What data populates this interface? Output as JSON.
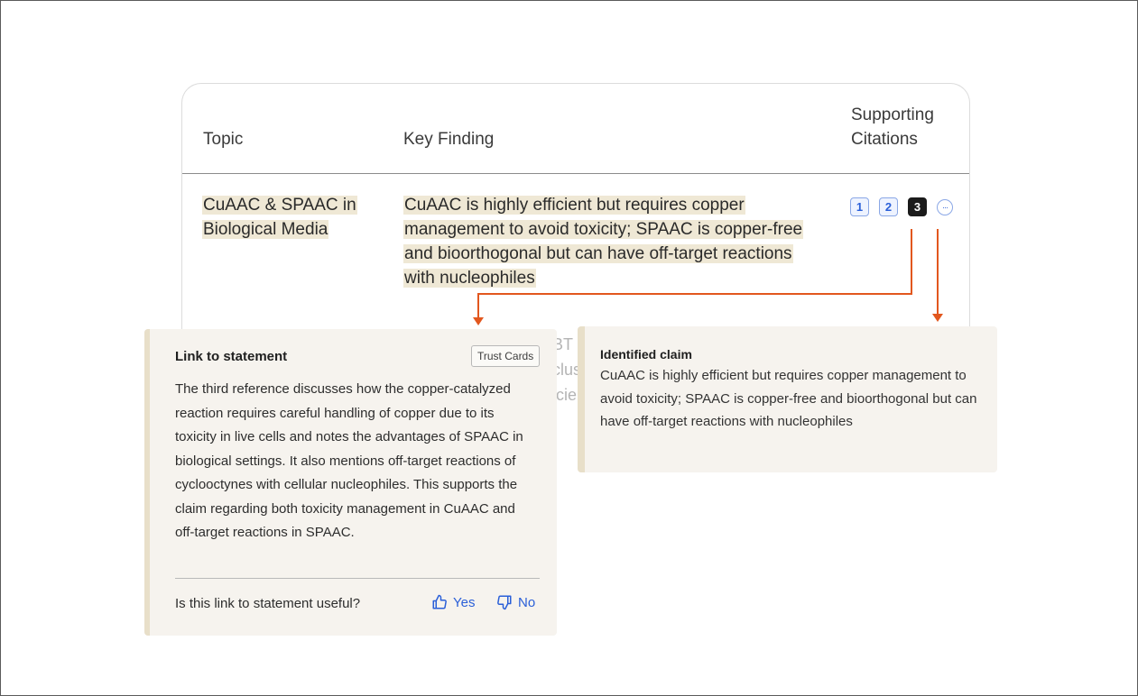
{
  "table": {
    "headers": {
      "topic": "Topic",
      "key_finding": "Key Finding",
      "citations": "Supporting Citations"
    },
    "row": {
      "topic": "CuAAC & SPAAC in Biological Media",
      "key_finding": "CuAAC is highly efficient but requires copper management to avoid toxicity; SPAAC is copper-free and bioorthogonal but can have off-target reactions with nucleophiles",
      "citations": [
        "1",
        "2",
        "3"
      ],
      "more_label": "···"
    },
    "obscured_fragments": [
      "BT",
      "clus",
      "icie"
    ]
  },
  "link_card": {
    "title": "Link to statement",
    "trust_button": "Trust Cards",
    "body": "The third reference discusses how the copper-catalyzed reaction requires careful handling of copper due to its toxicity in live cells and notes the advantages of SPAAC in biological settings. It also mentions off-target reactions of cyclooctynes with cellular nucleophiles. This supports the claim regarding both toxicity management in CuAAC and off-target reactions in SPAAC.",
    "feedback_question": "Is this link to statement useful?",
    "yes_label": "Yes",
    "no_label": "No"
  },
  "claim_card": {
    "label": "Identified claim",
    "text": "CuAAC is highly efficient but requires copper management to avoid toxicity; SPAAC is copper-free and bioorthogonal but can have off-target reactions with nucleophiles"
  },
  "colors": {
    "highlight": "#efe8d5",
    "card_bg": "#f6f3ee",
    "accent_blue": "#2a5fd8",
    "connector": "#e2571e"
  }
}
